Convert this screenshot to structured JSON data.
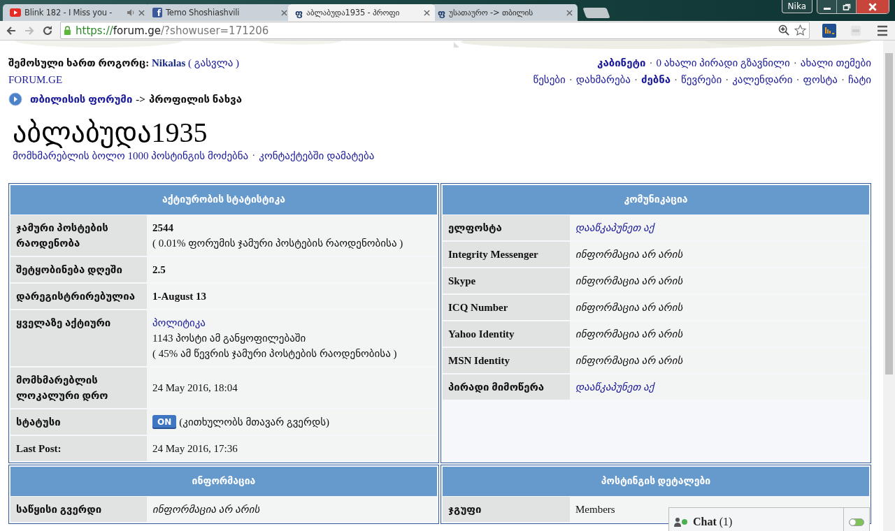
{
  "browser": {
    "tabs": [
      {
        "title": "Blink 182 - I Miss you -",
        "selected": false,
        "audio": true,
        "favicon": {
          "kind": "video"
        }
      },
      {
        "title": "Temo Shoshiashvili",
        "selected": false,
        "audio": false,
        "favicon": {
          "kind": "square-letter",
          "glyph": "f"
        }
      },
      {
        "title": "აბლაბუდა1935 - პროფი",
        "selected": true,
        "audio": false,
        "favicon": {
          "kind": "letter",
          "glyph": "ფ"
        }
      },
      {
        "title": "უსათაურო -> თბილის",
        "selected": false,
        "audio": false,
        "favicon": {
          "kind": "letter",
          "glyph": "ფ"
        }
      }
    ],
    "profile": "Nika",
    "url": {
      "scheme": "https://",
      "host": "forum.ge",
      "path": "/?showuser=171206"
    }
  },
  "header": {
    "login_label": "შემოსული ხართ როგორც:",
    "user": "Nikalas",
    "logout": "( გასვლა )",
    "site": "FORUM.GE",
    "separator": "·",
    "top_links": [
      {
        "text": "კაბინეტი",
        "bold": true
      },
      {
        "text": "0 ახალი პირადი გზავნილი",
        "bold": false
      },
      {
        "text": "ახალი თემები",
        "bold": false
      }
    ],
    "nav_links": [
      {
        "text": "წესები",
        "bold": false
      },
      {
        "text": "დახმარება",
        "bold": false
      },
      {
        "text": "ძებნა",
        "bold": true
      },
      {
        "text": "წევრები",
        "bold": false
      },
      {
        "text": "კალენდარი",
        "bold": false
      },
      {
        "text": "ფოსტა",
        "bold": false
      },
      {
        "text": "ჩატი",
        "bold": false
      }
    ]
  },
  "breadcrumb": {
    "forum": "თბილისის ფორუმი",
    "separator": "->",
    "page": "პროფილის ნახვა"
  },
  "profile": {
    "name": "აბლაბუდა1935",
    "actions": [
      "მომხმარებლის ბოლო 1000 პოსტინგის მოძებნა",
      "კონტაქტებში დამატება"
    ]
  },
  "panels": [
    {
      "title": "აქტიურობის სტატისტიკა",
      "rows": [
        {
          "label": "ჯამური პოსტების რაოდენობა",
          "lines": [
            {
              "kind": "bold",
              "text": "2544"
            },
            {
              "kind": "plain",
              "text": "( 0.01% ფორუმის ჯამური პოსტების რაოდენობისა )"
            }
          ]
        },
        {
          "label": "შეტყობინება დღეში",
          "lines": [
            {
              "kind": "bold",
              "text": "2.5"
            }
          ]
        },
        {
          "label": "დარეგისტრირებულია",
          "lines": [
            {
              "kind": "bold",
              "text": "1-August 13"
            }
          ]
        },
        {
          "label": "ყველაზე აქტიური",
          "lines": [
            {
              "kind": "link",
              "text": "პოლიტიკა"
            },
            {
              "kind": "plain",
              "text": "1143 პოსტი ამ განყოფილებაში"
            },
            {
              "kind": "plain",
              "text": "( 45% ამ წევრის ჯამური პოსტების რაოდენობისა )"
            }
          ]
        },
        {
          "label": "მომხმარებლის ლოკალური დრო",
          "lines": [
            {
              "kind": "plain",
              "text": "24 May 2016, 18:04"
            }
          ]
        },
        {
          "label": "სტატუსი",
          "lines": [
            {
              "kind": "status",
              "badge": "ON",
              "on": true,
              "text": "(კითხულობს მთავარ გვერდს)"
            }
          ]
        },
        {
          "label": "Last Post:",
          "lines": [
            {
              "kind": "plain",
              "text": "24 May 2016, 17:36"
            }
          ]
        }
      ]
    },
    {
      "title": "კომუნიკაცია",
      "rows": [
        {
          "label": "ელფოსტა",
          "lines": [
            {
              "kind": "italic-link",
              "text": "დააწკაპუნეთ აქ"
            }
          ]
        },
        {
          "label": "Integrity Messenger",
          "lines": [
            {
              "kind": "italic",
              "text": "ინფორმაცია არ არის"
            }
          ]
        },
        {
          "label": "Skype",
          "lines": [
            {
              "kind": "italic",
              "text": "ინფორმაცია არ არის"
            }
          ]
        },
        {
          "label": "ICQ Number",
          "lines": [
            {
              "kind": "italic",
              "text": "ინფორმაცია არ არის"
            }
          ]
        },
        {
          "label": "Yahoo Identity",
          "lines": [
            {
              "kind": "italic",
              "text": "ინფორმაცია არ არის"
            }
          ]
        },
        {
          "label": "MSN Identity",
          "lines": [
            {
              "kind": "italic",
              "text": "ინფორმაცია არ არის"
            }
          ]
        },
        {
          "label": "პირადი მიმოწერა",
          "lines": [
            {
              "kind": "italic-link",
              "text": "დააწკაპუნეთ აქ"
            }
          ]
        }
      ]
    },
    {
      "title": "ინფორმაცია",
      "rows": [
        {
          "label": "საწყისი გვერდი",
          "lines": [
            {
              "kind": "italic",
              "text": "ინფორმაცია არ არის"
            }
          ]
        }
      ]
    },
    {
      "title": "პოსტინგის დეტალები",
      "rows": [
        {
          "label": "ჯგუფი",
          "lines": [
            {
              "kind": "plain",
              "text": "Members"
            }
          ]
        }
      ]
    }
  ],
  "chat": {
    "label": "**Chat** (1)"
  }
}
